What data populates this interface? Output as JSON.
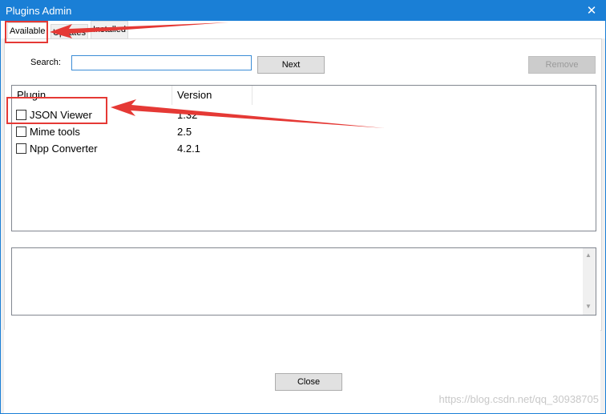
{
  "window": {
    "title": "Plugins Admin",
    "close_glyph": "✕"
  },
  "tabs": [
    {
      "label": "Available"
    },
    {
      "label": "Updates"
    },
    {
      "label": "Installed"
    }
  ],
  "search": {
    "label": "Search:",
    "value": ""
  },
  "buttons": {
    "next": "Next",
    "remove": "Remove",
    "close": "Close"
  },
  "list": {
    "columns": [
      "Plugin",
      "Version"
    ],
    "rows": [
      {
        "name": "JSON Viewer",
        "version": "1.32",
        "checked": false
      },
      {
        "name": "Mime tools",
        "version": "2.5",
        "checked": false
      },
      {
        "name": "Npp Converter",
        "version": "4.2.1",
        "checked": false
      }
    ]
  },
  "description": {
    "text": ""
  },
  "scrollbar": {
    "up_glyph": "▲",
    "down_glyph": "▼"
  },
  "watermark": "https://blog.csdn.net/qq_30938705",
  "colors": {
    "titlebar": "#1a7fd6",
    "annotation": "#e53935"
  }
}
